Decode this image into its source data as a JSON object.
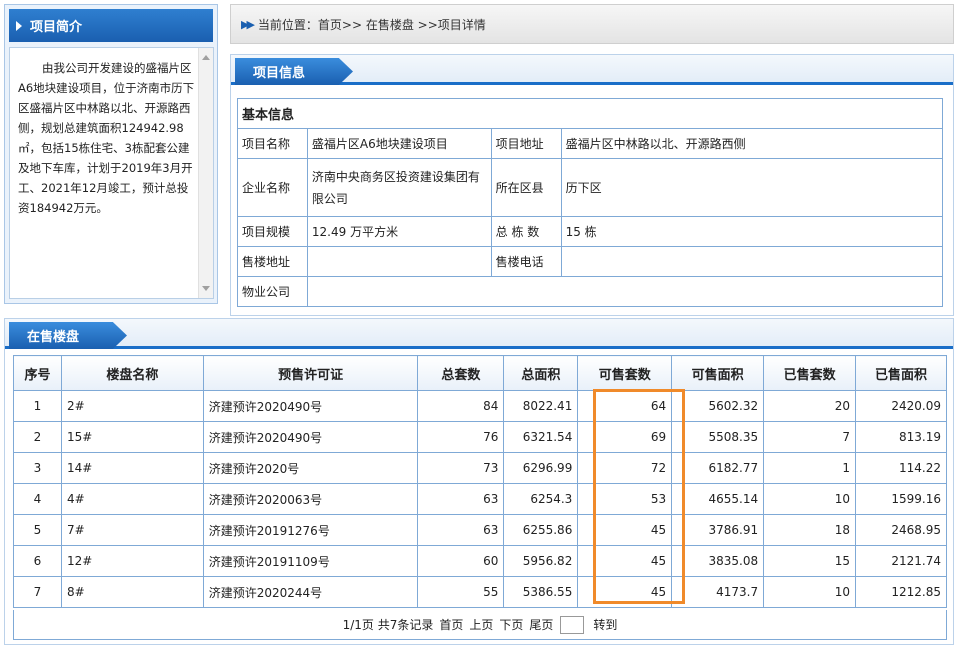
{
  "intro": {
    "title": "项目简介",
    "text": "由我公司开发建设的盛福片区A6地块建设项目，位于济南市历下区盛福片区中林路以北、开源路西侧，规划总建筑面积124942.98㎡，包括15栋住宅、3栋配套公建及地下车库，计划于2019年3月开工、2021年12月竣工，预计总投资184942万元。"
  },
  "breadcrumb": {
    "arrows": "▶▶",
    "text": "当前位置：首页>> 在售楼盘 >>项目详情"
  },
  "project_info": {
    "tab_title": "项目信息",
    "basic_heading": "基本信息",
    "rows": [
      {
        "l1": "项目名称",
        "v1": "盛福片区A6地块建设项目",
        "l2": "项目地址",
        "v2": "盛福片区中林路以北、开源路西侧"
      },
      {
        "l1": "企业名称",
        "v1": "济南中央商务区投资建设集团有限公司",
        "l2": "所在区县",
        "v2": "历下区"
      },
      {
        "l1": "项目规模",
        "v1": "12.49 万平方米",
        "l2": "总 栋 数",
        "v2": "15 栋"
      },
      {
        "l1": "售楼地址",
        "v1": "",
        "l2": "售楼电话",
        "v2": ""
      }
    ],
    "property_label": "物业公司",
    "property_value": ""
  },
  "sales": {
    "tab_title": "在售楼盘",
    "headers": [
      "序号",
      "楼盘名称",
      "预售许可证",
      "总套数",
      "总面积",
      "可售套数",
      "可售面积",
      "已售套数",
      "已售面积"
    ],
    "rows": [
      [
        "1",
        "2#",
        "济建预许2020490号",
        "84",
        "8022.41",
        "64",
        "5602.32",
        "20",
        "2420.09"
      ],
      [
        "2",
        "15#",
        "济建预许2020490号",
        "76",
        "6321.54",
        "69",
        "5508.35",
        "7",
        "813.19"
      ],
      [
        "3",
        "14#",
        "济建预许2020号",
        "73",
        "6296.99",
        "72",
        "6182.77",
        "1",
        "114.22"
      ],
      [
        "4",
        "4#",
        "济建预许2020063号",
        "63",
        "6254.3",
        "53",
        "4655.14",
        "10",
        "1599.16"
      ],
      [
        "5",
        "7#",
        "济建预许20191276号",
        "63",
        "6255.86",
        "45",
        "3786.91",
        "18",
        "2468.95"
      ],
      [
        "6",
        "12#",
        "济建预许20191109号",
        "60",
        "5956.82",
        "45",
        "3835.08",
        "15",
        "2121.74"
      ],
      [
        "7",
        "8#",
        "济建预许2020244号",
        "55",
        "5386.55",
        "45",
        "4173.7",
        "10",
        "1212.85"
      ]
    ],
    "pager": {
      "summary": "1/1页 共7条记录",
      "first": "首页",
      "prev": "上页",
      "next": "下页",
      "last": "尾页",
      "go": "转到"
    }
  },
  "colors": {
    "accent": "#1a5fb0",
    "highlight": "#f08a2a",
    "table_border": "#7fa9d6"
  }
}
